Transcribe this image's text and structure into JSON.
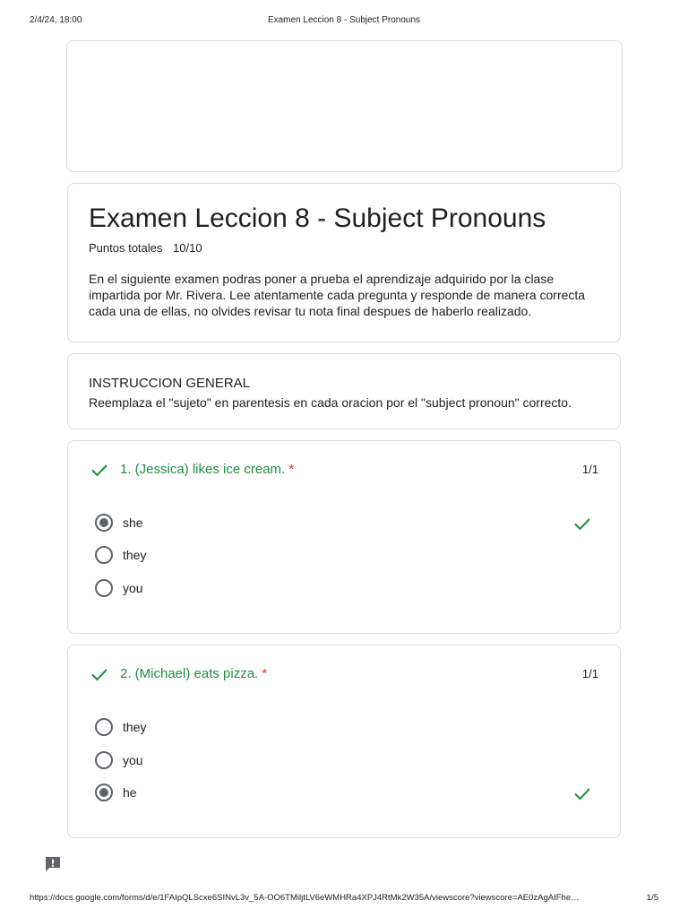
{
  "print_header": {
    "datetime": "2/4/24, 18:00",
    "title": "Examen Leccion 8 - Subject Pronouns"
  },
  "form": {
    "title": "Examen Leccion 8 - Subject Pronouns",
    "score_label": "Puntos totales",
    "score_value": "10/10",
    "description": "En el siguiente examen podras poner a prueba el aprendizaje adquirido por la clase impartida por Mr. Rivera. Lee atentamente cada pregunta y responde de manera correcta cada una de ellas, no olvides revisar tu nota final despues de haberlo realizado."
  },
  "instructions": {
    "title": "INSTRUCCION GENERAL",
    "text": "Reemplaza el \"sujeto\" en parentesis en cada oracion por el \"subject pronoun\" correcto."
  },
  "questions": [
    {
      "text": "1. (Jessica) likes ice cream.",
      "required_mark": "*",
      "points": "1/1",
      "status": "correct",
      "options": [
        {
          "label": "she",
          "selected": true,
          "correct": true
        },
        {
          "label": "they",
          "selected": false,
          "correct": false
        },
        {
          "label": "you",
          "selected": false,
          "correct": false
        }
      ]
    },
    {
      "text": "2. (Michael) eats pizza.",
      "required_mark": "*",
      "points": "1/1",
      "status": "correct",
      "options": [
        {
          "label": "they",
          "selected": false,
          "correct": false
        },
        {
          "label": "you",
          "selected": false,
          "correct": false
        },
        {
          "label": "he",
          "selected": true,
          "correct": true
        }
      ]
    }
  ],
  "icons": {
    "correct": "check-icon",
    "feedback": "report-feedback-icon"
  },
  "colors": {
    "correct_green": "#1e8e3e",
    "required_red": "#d93025",
    "radio_gray": "#5f6368",
    "card_border": "#dadce0"
  },
  "print_footer": {
    "url": "https://docs.google.com/forms/d/e/1FAIpQLScxe6SINvL3v_5A-OO6TMiljtLV6eWMHRa4XPJ4RtMk2W35A/viewscore?viewscore=AE0zAgAIFhe…",
    "page": "1/5"
  }
}
